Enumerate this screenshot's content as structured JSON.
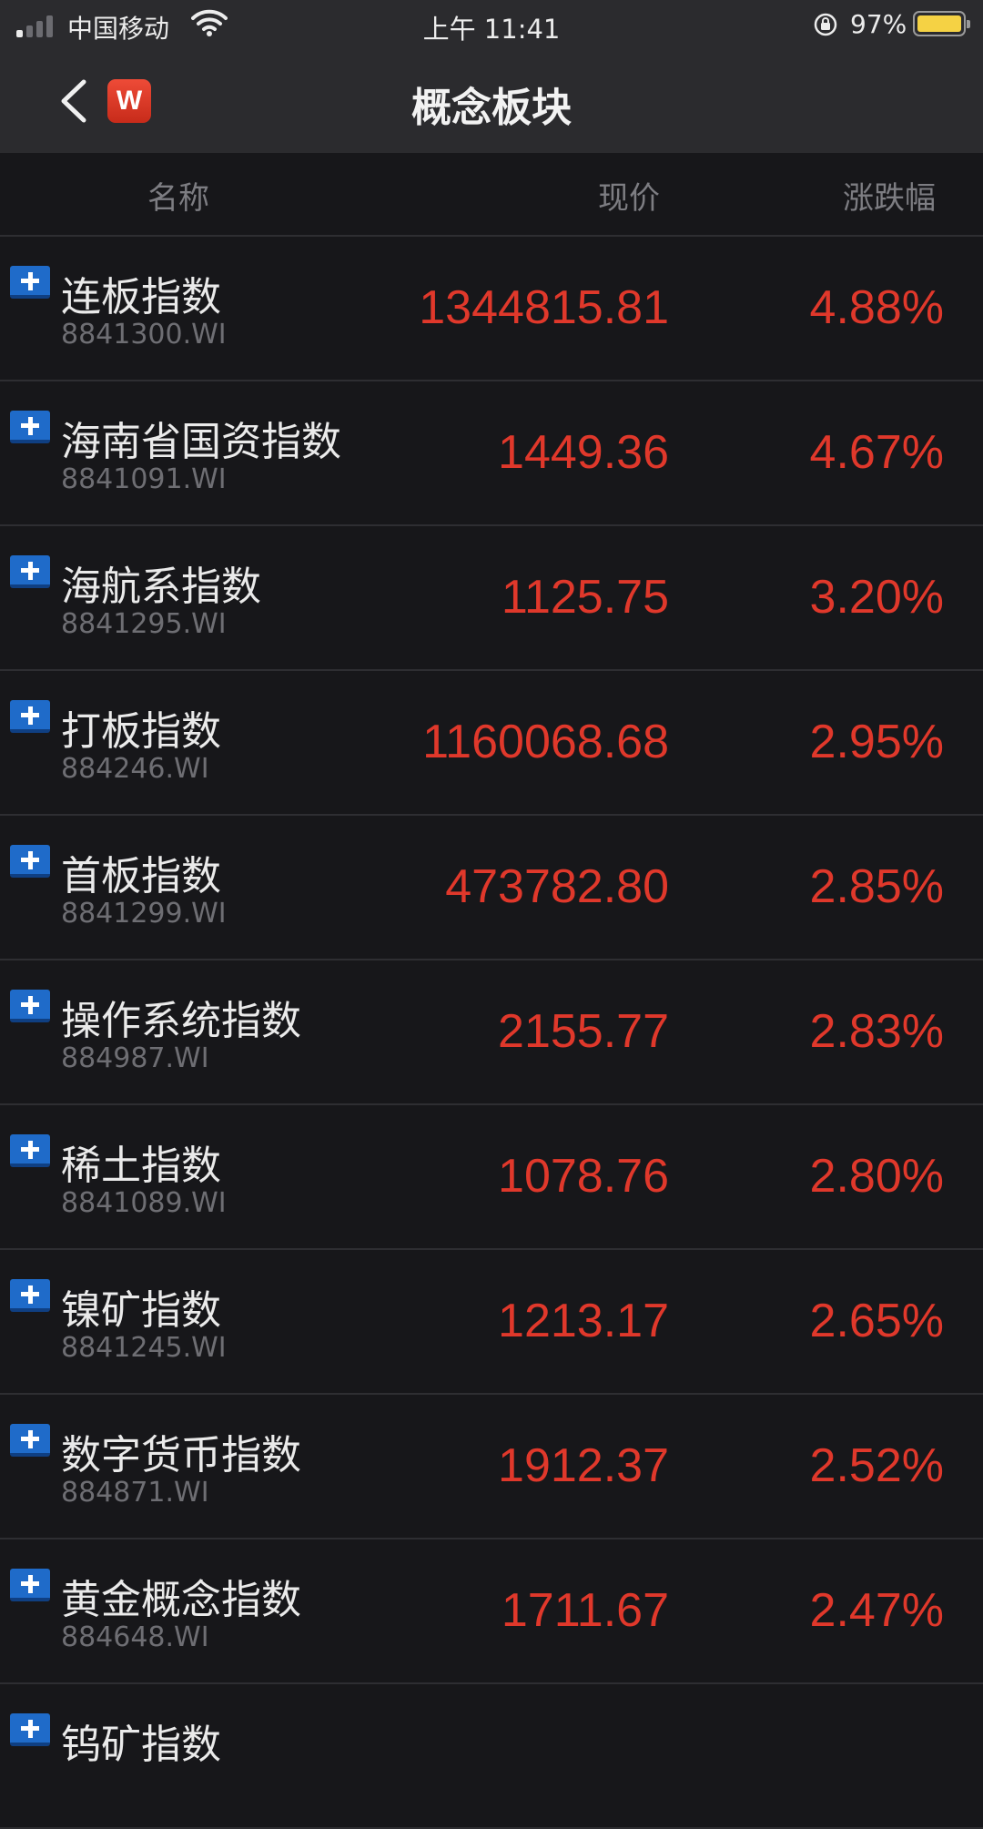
{
  "status_bar": {
    "carrier": "中国移动",
    "time": "上午 11:41",
    "battery_pct": "97%"
  },
  "nav": {
    "title": "概念板块",
    "logo_letter": "W"
  },
  "columns": {
    "name": "名称",
    "price": "现价",
    "change": "涨跌幅"
  },
  "rows": [
    {
      "name": "连板指数",
      "code": "8841300.WI",
      "price": "1344815.81",
      "change": "4.88%"
    },
    {
      "name": "海南省国资指数",
      "code": "8841091.WI",
      "price": "1449.36",
      "change": "4.67%"
    },
    {
      "name": "海航系指数",
      "code": "8841295.WI",
      "price": "1125.75",
      "change": "3.20%"
    },
    {
      "name": "打板指数",
      "code": "884246.WI",
      "price": "1160068.68",
      "change": "2.95%"
    },
    {
      "name": "首板指数",
      "code": "8841299.WI",
      "price": "473782.80",
      "change": "2.85%"
    },
    {
      "name": "操作系统指数",
      "code": "884987.WI",
      "price": "2155.77",
      "change": "2.83%"
    },
    {
      "name": "稀土指数",
      "code": "8841089.WI",
      "price": "1078.76",
      "change": "2.80%"
    },
    {
      "name": "镍矿指数",
      "code": "8841245.WI",
      "price": "1213.17",
      "change": "2.65%"
    },
    {
      "name": "数字货币指数",
      "code": "884871.WI",
      "price": "1912.37",
      "change": "2.52%"
    },
    {
      "name": "黄金概念指数",
      "code": "884648.WI",
      "price": "1711.67",
      "change": "2.47%"
    },
    {
      "name": "钨矿指数",
      "code": "",
      "price": "",
      "change": ""
    }
  ],
  "colors": {
    "up": "#e0382b",
    "background": "#17171a",
    "bar": "#2b2b2e",
    "plus_button": "#1f6bc9",
    "battery_fill": "#f5d244"
  }
}
